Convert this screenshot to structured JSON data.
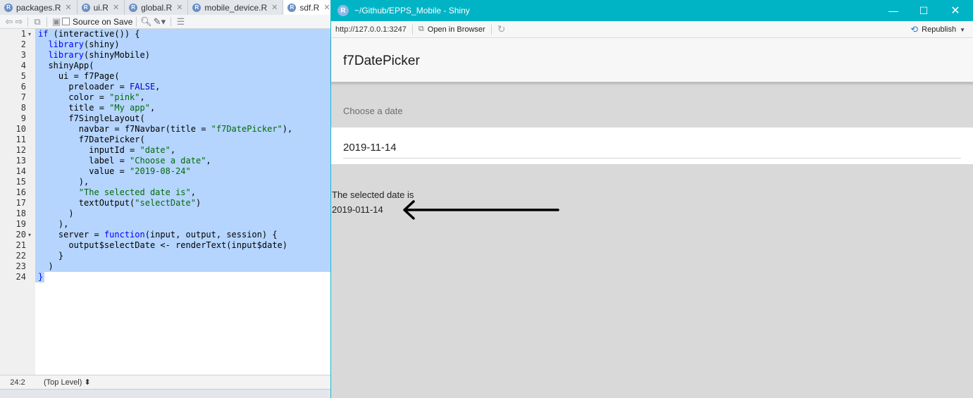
{
  "editor": {
    "tabs": [
      {
        "label": "packages.R"
      },
      {
        "label": "ui.R"
      },
      {
        "label": "global.R"
      },
      {
        "label": "mobile_device.R"
      },
      {
        "label": "sdf.R"
      }
    ],
    "toolbar": {
      "source_on_save_label": "Source on Save"
    },
    "code_lines": [
      {
        "n": "1",
        "fold": "▾",
        "parts": [
          {
            "t": "if",
            "c": "kw"
          },
          {
            "t": " (interactive()) {",
            "c": "fn"
          }
        ]
      },
      {
        "n": "2",
        "fold": "",
        "parts": [
          {
            "t": "  ",
            "c": "fn"
          },
          {
            "t": "library",
            "c": "kw"
          },
          {
            "t": "(shiny)",
            "c": "fn"
          }
        ]
      },
      {
        "n": "3",
        "fold": "",
        "parts": [
          {
            "t": "  ",
            "c": "fn"
          },
          {
            "t": "library",
            "c": "kw"
          },
          {
            "t": "(shinyMobile)",
            "c": "fn"
          }
        ]
      },
      {
        "n": "4",
        "fold": "",
        "parts": [
          {
            "t": "  shinyApp(",
            "c": "fn"
          }
        ]
      },
      {
        "n": "5",
        "fold": "",
        "parts": [
          {
            "t": "    ui = f7Page(",
            "c": "fn"
          }
        ]
      },
      {
        "n": "6",
        "fold": "",
        "parts": [
          {
            "t": "      preloader = ",
            "c": "fn"
          },
          {
            "t": "FALSE",
            "c": "num"
          },
          {
            "t": ",",
            "c": "fn"
          }
        ]
      },
      {
        "n": "7",
        "fold": "",
        "parts": [
          {
            "t": "      color = ",
            "c": "fn"
          },
          {
            "t": "\"pink\"",
            "c": "str"
          },
          {
            "t": ",",
            "c": "fn"
          }
        ]
      },
      {
        "n": "8",
        "fold": "",
        "parts": [
          {
            "t": "      title = ",
            "c": "fn"
          },
          {
            "t": "\"My app\"",
            "c": "str"
          },
          {
            "t": ",",
            "c": "fn"
          }
        ]
      },
      {
        "n": "9",
        "fold": "",
        "parts": [
          {
            "t": "      f7SingleLayout(",
            "c": "fn"
          }
        ]
      },
      {
        "n": "10",
        "fold": "",
        "parts": [
          {
            "t": "        navbar = f7Navbar(title = ",
            "c": "fn"
          },
          {
            "t": "\"f7DatePicker\"",
            "c": "str"
          },
          {
            "t": "),",
            "c": "fn"
          }
        ]
      },
      {
        "n": "11",
        "fold": "",
        "parts": [
          {
            "t": "        f7DatePicker(",
            "c": "fn"
          }
        ]
      },
      {
        "n": "12",
        "fold": "",
        "parts": [
          {
            "t": "          inputId = ",
            "c": "fn"
          },
          {
            "t": "\"date\"",
            "c": "str"
          },
          {
            "t": ",",
            "c": "fn"
          }
        ]
      },
      {
        "n": "13",
        "fold": "",
        "parts": [
          {
            "t": "          label = ",
            "c": "fn"
          },
          {
            "t": "\"Choose a date\"",
            "c": "str"
          },
          {
            "t": ",",
            "c": "fn"
          }
        ]
      },
      {
        "n": "14",
        "fold": "",
        "parts": [
          {
            "t": "          value = ",
            "c": "fn"
          },
          {
            "t": "\"2019-08-24\"",
            "c": "str"
          }
        ]
      },
      {
        "n": "15",
        "fold": "",
        "parts": [
          {
            "t": "        ),",
            "c": "fn"
          }
        ]
      },
      {
        "n": "16",
        "fold": "",
        "parts": [
          {
            "t": "        ",
            "c": "fn"
          },
          {
            "t": "\"The selected date is\"",
            "c": "str"
          },
          {
            "t": ",",
            "c": "fn"
          }
        ]
      },
      {
        "n": "17",
        "fold": "",
        "parts": [
          {
            "t": "        textOutput(",
            "c": "fn"
          },
          {
            "t": "\"selectDate\"",
            "c": "str"
          },
          {
            "t": ")",
            "c": "fn"
          }
        ]
      },
      {
        "n": "18",
        "fold": "",
        "parts": [
          {
            "t": "      )",
            "c": "fn"
          }
        ]
      },
      {
        "n": "19",
        "fold": "",
        "parts": [
          {
            "t": "    ),",
            "c": "fn"
          }
        ]
      },
      {
        "n": "20",
        "fold": "▾",
        "parts": [
          {
            "t": "    server = ",
            "c": "fn"
          },
          {
            "t": "function",
            "c": "kw"
          },
          {
            "t": "(input, output, session) {",
            "c": "fn"
          }
        ]
      },
      {
        "n": "21",
        "fold": "",
        "parts": [
          {
            "t": "      output$selectDate <- renderText(input$date)",
            "c": "fn"
          }
        ]
      },
      {
        "n": "22",
        "fold": "",
        "parts": [
          {
            "t": "    }",
            "c": "fn"
          }
        ]
      },
      {
        "n": "23",
        "fold": "",
        "parts": [
          {
            "t": "  )",
            "c": "fn"
          }
        ]
      },
      {
        "n": "24",
        "fold": "",
        "parts": [
          {
            "t": "}",
            "c": "kw"
          }
        ]
      }
    ],
    "status": {
      "position": "24:2",
      "scope": "(Top Level) ⬍"
    }
  },
  "shiny": {
    "window_title": "~/Github/EPPS_Mobile - Shiny",
    "url": "http://127.0.0.1:3247",
    "open_in_browser_label": "Open in Browser",
    "republish_label": "Republish",
    "navbar_title": "f7DatePicker",
    "date_label": "Choose a date",
    "date_value": "2019-11-14",
    "selected_text": "The selected date is",
    "selected_value": "2019-011-14",
    "colors": {
      "titlebar": "#00b4c6",
      "content_bg": "#d9d9d9",
      "selection": "#b5d5ff"
    }
  }
}
